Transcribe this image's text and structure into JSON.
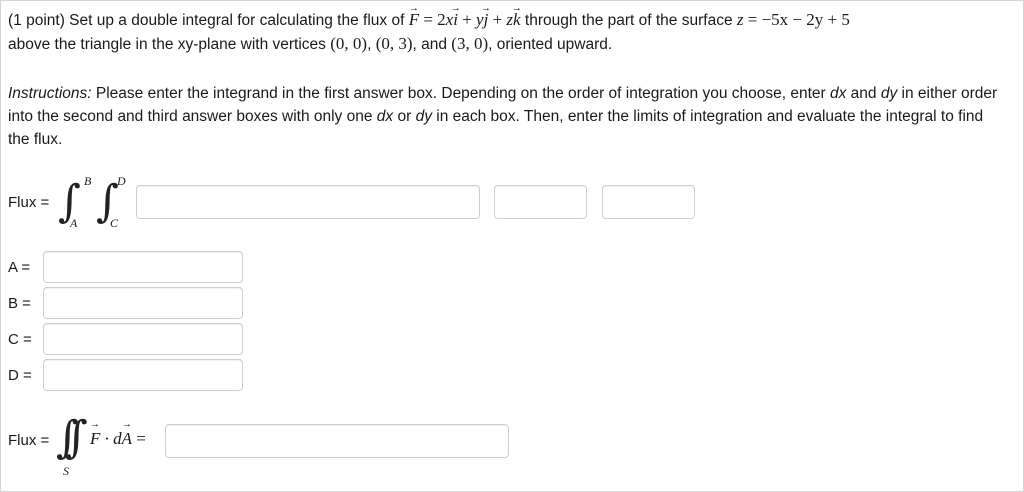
{
  "problem": {
    "points": "(1 point)",
    "lead": " Set up a double integral for calculating the flux of ",
    "F_symbol": "F",
    "equals": " = 2",
    "x1": "x",
    "i1": "i",
    "plus1": " + ",
    "y1": "y",
    "j1": "j",
    "plus2": " + ",
    "z1": "z",
    "k1": "k",
    "through_text": " through the part of the surface ",
    "z2": "z",
    "surface_eq": " = −5x − 2y + 5",
    "line2_text": "above the triangle in the xy-plane with vertices ",
    "vertex1": "(0, 0)",
    "sep1": ", ",
    "vertex2": "(0, 3)",
    "sep2": ", and ",
    "vertex3": "(3, 0)",
    "end_text": ", oriented upward."
  },
  "instructions": {
    "label": "Instructions:",
    "t1": " Please enter the integrand in the first answer box. Depending on the order of integration you choose, enter ",
    "dx1": "dx",
    "t2": " and ",
    "dy1": "dy",
    "t3": " in either order into the second and third answer boxes with only one ",
    "dx2": "dx",
    "t4": " or ",
    "dy2": "dy",
    "t5": " in each box. Then, enter the limits of integration and evaluate the integral to find the flux."
  },
  "flux_setup": {
    "label": "Flux =",
    "upper_outer": "B",
    "lower_outer": "A",
    "upper_inner": "D",
    "lower_inner": "C",
    "integrand_value": "",
    "diff1_value": "",
    "diff2_value": ""
  },
  "limits": [
    {
      "label": "A =",
      "value": ""
    },
    {
      "label": "B =",
      "value": ""
    },
    {
      "label": "C =",
      "value": ""
    },
    {
      "label": "D =",
      "value": ""
    }
  ],
  "flux_final": {
    "label": "Flux =",
    "region": "S",
    "F_symbol": "F",
    "dot": " · d",
    "A_symbol": "A",
    "equals": " =",
    "value": ""
  }
}
